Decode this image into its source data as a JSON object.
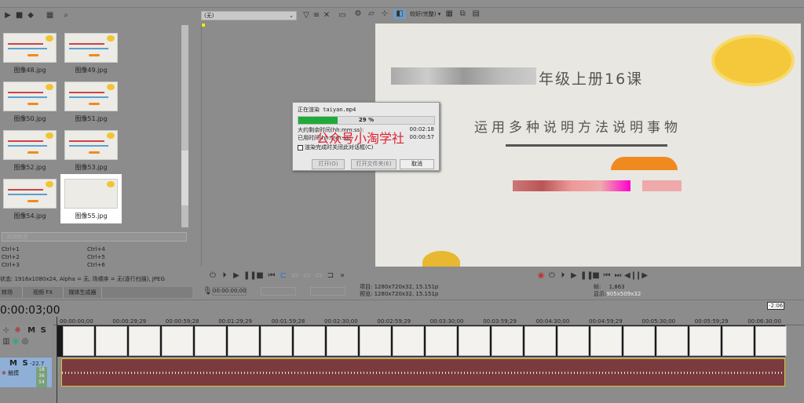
{
  "explorer": {
    "items": [
      {
        "name": "图像48.jpg"
      },
      {
        "name": "图像49.jpg"
      },
      {
        "name": "图像50.jpg"
      },
      {
        "name": "图像51.jpg"
      },
      {
        "name": "图像52.jpg"
      },
      {
        "name": "图像53.jpg"
      },
      {
        "name": "图像54.jpg"
      },
      {
        "name": "图像55.jpg",
        "selected": true
      }
    ],
    "tag_placeholder": "添加标签",
    "shortcuts": [
      "Ctrl+1",
      "Ctrl+4",
      "Ctrl+2",
      "Ctrl+5",
      "Ctrl+3",
      "Ctrl+6"
    ],
    "info": "状态: 1916x1080x24, Alpha = 无, 场顺序 = 无(逐行扫描), JPEG",
    "tabs": [
      "转场",
      "视频 FX",
      "媒体生成器"
    ]
  },
  "trimmer": {
    "dropdown": "(无)",
    "timecode": "00:00:00;00"
  },
  "preview": {
    "quality": "较好(完整)",
    "title_line": "年级上册16课",
    "subtitle": "运用多种说明方法说明事物",
    "project": "项目: 1280x720x32, 15.151p",
    "preview_info": "预览: 1280x720x32, 15.151p",
    "frame_label": "帧:",
    "frame_value": "1,863",
    "display_label": "显示:",
    "display_value": "905x509x32"
  },
  "render_dialog": {
    "title": "正在渲染 taiyan.mp4",
    "progress": 29,
    "progress_label": "29 %",
    "remaining_label": "大约剩余时间(hh:mm:ss):",
    "remaining": "00:02:18",
    "elapsed_label": "已用时间(hh:mm:ss):",
    "elapsed": "00:00:57",
    "close_checkbox": "渲染完成时关闭此对话框(C)",
    "checked": false,
    "open": "打开(O)",
    "open_folder": "打开文件夹(E)",
    "cancel": "取消",
    "watermark": "公众号小淘学社"
  },
  "timeline": {
    "timecode": "0:00:03;00",
    "end_marker": "-2:06",
    "ticks": [
      "00:00:00;00",
      "00:00:29;29",
      "00:00:59;28",
      "00:01:29;29",
      "00:01:59;28",
      "00:02:30;00",
      "00:02:59;29",
      "00:03:30;00",
      "00:03:59;29",
      "00:04:30;00",
      "00:04:59;29",
      "00:05:30;00",
      "00:05:59;29",
      "00:06:30;00"
    ],
    "video_track": {
      "m": "M",
      "s": "S"
    },
    "audio_track": {
      "m": "M",
      "s": "S",
      "level": "-22.7",
      "label": "触摸",
      "meter": [
        "18",
        "36",
        "54"
      ]
    }
  },
  "colors": {
    "progress": "#1faa3a",
    "audio_clip": "#7a3a3e",
    "watermark": "#e02030",
    "selection": "#ffffff"
  }
}
